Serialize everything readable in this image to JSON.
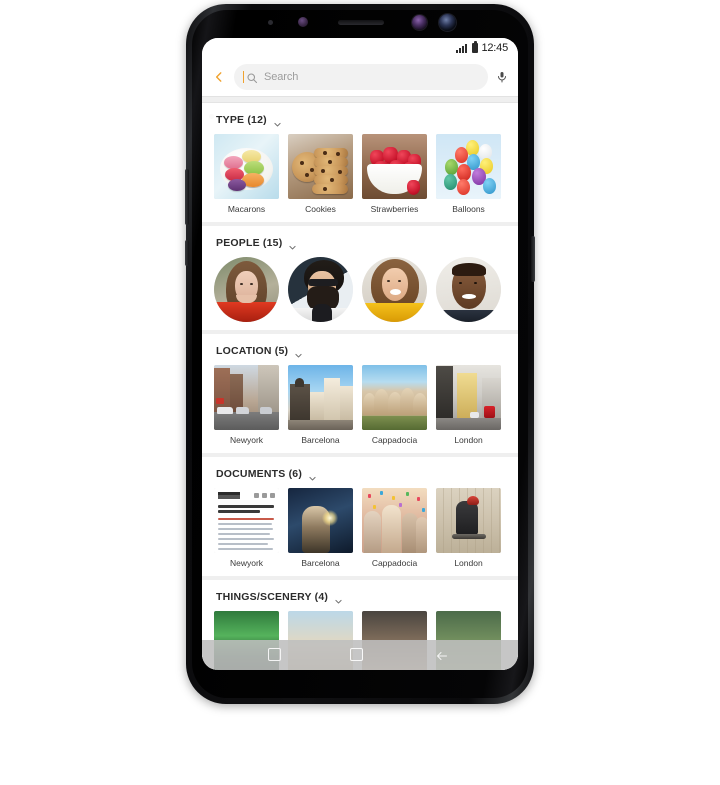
{
  "status_bar": {
    "time": "12:45",
    "signal_icon": "signal-bars-icon",
    "battery_icon": "battery-icon"
  },
  "search": {
    "back_icon": "back-chevron-icon",
    "placeholder": "Search",
    "value": "",
    "search_icon": "search-icon",
    "mic_icon": "mic-icon"
  },
  "accent_color": "#f0a22e",
  "sections": [
    {
      "title": "TYPE (12)",
      "chevron": "chevron-down-icon",
      "shape": "square",
      "items": [
        {
          "label": "Macarons",
          "art": "macarons"
        },
        {
          "label": "Cookies",
          "art": "cookies"
        },
        {
          "label": "Strawberries",
          "art": "strawberries"
        },
        {
          "label": "Balloons",
          "art": "balloons"
        }
      ]
    },
    {
      "title": "PEOPLE (15)",
      "chevron": "chevron-down-icon",
      "shape": "circle",
      "items": [
        {
          "label": "",
          "art": "face-woman-red"
        },
        {
          "label": "",
          "art": "face-man-beard"
        },
        {
          "label": "",
          "art": "face-woman-yellow"
        },
        {
          "label": "",
          "art": "face-man-smiling"
        }
      ]
    },
    {
      "title": "LOCATION (5)",
      "chevron": "chevron-down-icon",
      "shape": "square",
      "items": [
        {
          "label": "Newyork",
          "art": "newyork"
        },
        {
          "label": "Barcelona",
          "art": "barcelona"
        },
        {
          "label": "Cappadocia",
          "art": "cappadocia"
        },
        {
          "label": "London",
          "art": "london"
        }
      ]
    },
    {
      "title": "DOCUMENTS (6)",
      "chevron": "chevron-down-icon",
      "shape": "square",
      "items": [
        {
          "label": "Newyork",
          "art": "docpage"
        },
        {
          "label": "Barcelona",
          "art": "sparkler"
        },
        {
          "label": "Cappadocia",
          "art": "party"
        },
        {
          "label": "London",
          "art": "skate"
        }
      ]
    },
    {
      "title": "THINGS/SCENERY (4)",
      "chevron": "chevron-down-icon",
      "shape": "square",
      "items": [
        {
          "label": "",
          "art": "aurora"
        },
        {
          "label": "",
          "art": "beach"
        },
        {
          "label": "",
          "art": "cooking"
        },
        {
          "label": "",
          "art": "forest"
        }
      ]
    }
  ],
  "nav_bar": {
    "recents_icon": "recents-icon",
    "home_icon": "home-icon",
    "back_icon": "back-icon"
  },
  "device": {
    "sensors": [
      "proximity-sensor-icon",
      "iris-led-icon",
      "earpiece-speaker",
      "iris-scanner-icon",
      "front-camera-icon"
    ],
    "buttons": [
      "volume-button",
      "bixby-button",
      "power-button"
    ]
  }
}
